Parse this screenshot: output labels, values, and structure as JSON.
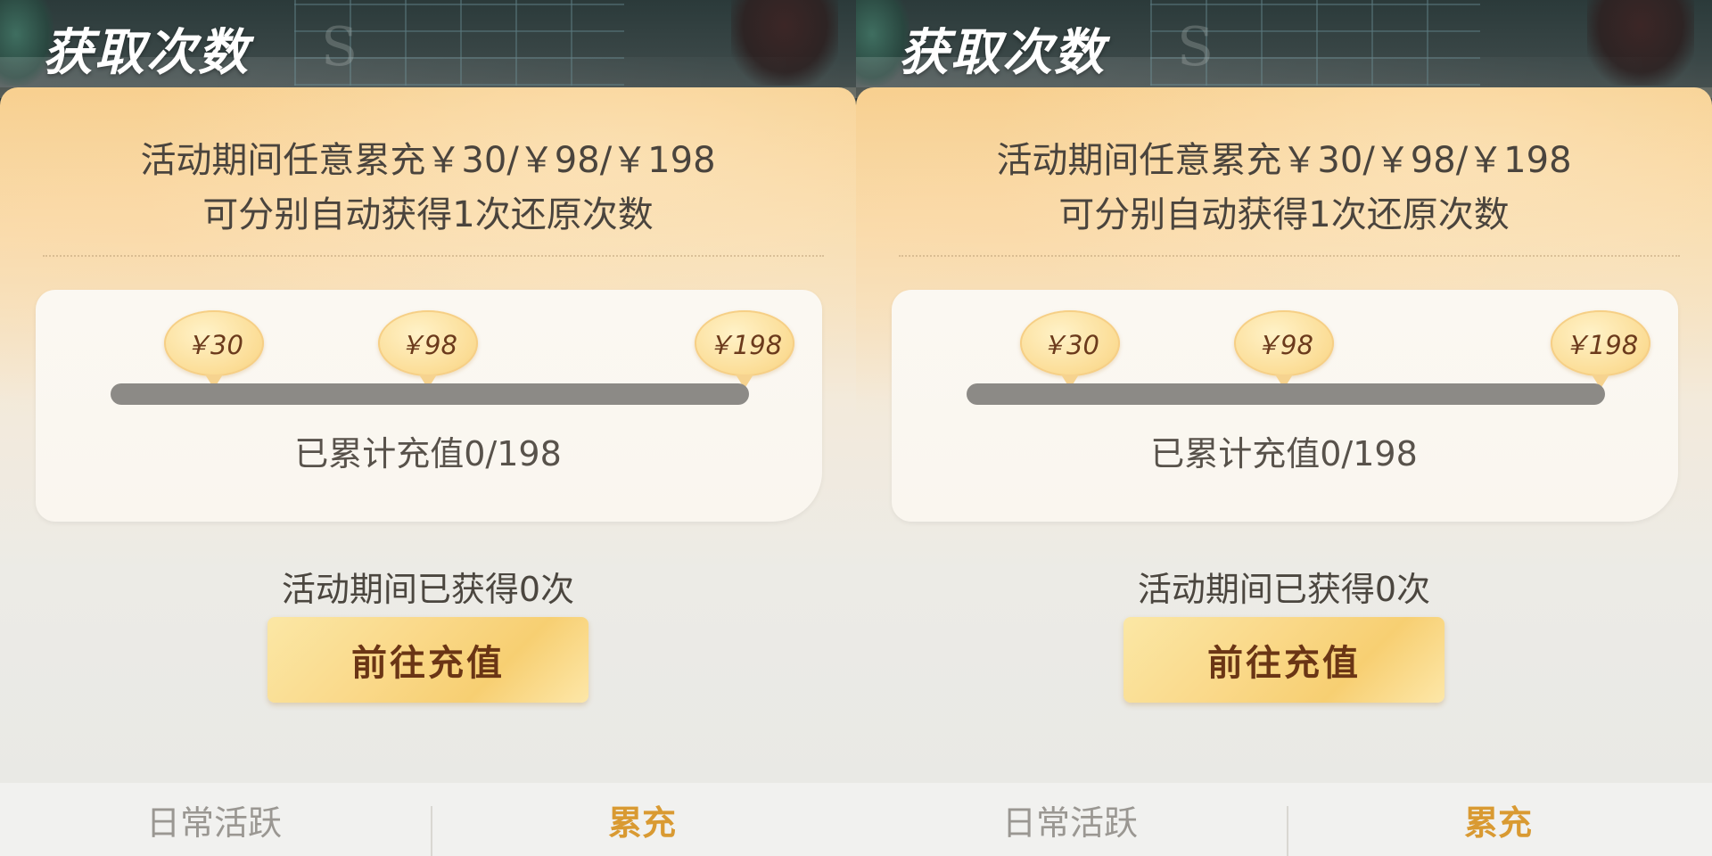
{
  "panels": [
    {
      "title": "获取次数",
      "description_line1": "活动期间任意累充￥30/￥98/￥198",
      "description_line2": "可分别自动获得1次还原次数",
      "milestones": [
        "￥30",
        "￥98",
        "￥198"
      ],
      "progress": {
        "current": 0,
        "target": 198,
        "label": "已累计充值0/198"
      },
      "earned_text": "活动期间已获得0次",
      "action_button": "前往充值",
      "tabs": [
        {
          "label": "日常活跃",
          "active": false
        },
        {
          "label": "累充",
          "active": true
        }
      ]
    },
    {
      "title": "获取次数",
      "description_line1": "活动期间任意累充￥30/￥98/￥198",
      "description_line2": "可分别自动获得1次还原次数",
      "milestones": [
        "￥30",
        "￥98",
        "￥198"
      ],
      "progress": {
        "current": 0,
        "target": 198,
        "label": "已累计充值0/198"
      },
      "earned_text": "活动期间已获得0次",
      "action_button": "前往充值",
      "tabs": [
        {
          "label": "日常活跃",
          "active": false
        },
        {
          "label": "累充",
          "active": true
        }
      ]
    }
  ],
  "colors": {
    "accent_tab": "#d99a32",
    "inactive_tab": "#9a9792",
    "button_text": "#6a3515",
    "track": "#8c8a86"
  }
}
